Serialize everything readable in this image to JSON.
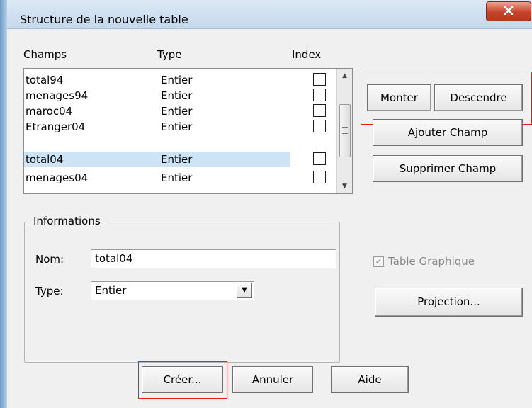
{
  "window": {
    "title": "Structure de la nouvelle table",
    "close_label": "x"
  },
  "columns": {
    "champs": "Champs",
    "type": "Type",
    "index": "Index"
  },
  "fields": [
    {
      "name": "total94",
      "type": "Entier",
      "indexed": false,
      "selected": false
    },
    {
      "name": "menages94",
      "type": "Entier",
      "indexed": false,
      "selected": false
    },
    {
      "name": "maroc04",
      "type": "Entier",
      "indexed": false,
      "selected": false
    },
    {
      "name": "Etranger04",
      "type": "Entier",
      "indexed": false,
      "selected": false
    },
    {
      "name": "total04",
      "type": "Entier",
      "indexed": false,
      "selected": true
    },
    {
      "name": "menages04",
      "type": "Entier",
      "indexed": false,
      "selected": false
    }
  ],
  "buttons": {
    "monter": "Monter",
    "descendre": "Descendre",
    "ajouter": "Ajouter Champ",
    "supprimer": "Supprimer Champ",
    "projection": "Projection...",
    "creer": "Créer...",
    "annuler": "Annuler",
    "aide": "Aide"
  },
  "informations": {
    "group_title": "Informations",
    "nom_label": "Nom:",
    "nom_value": "total04",
    "type_label": "Type:",
    "type_value": "Entier"
  },
  "table_graphique": {
    "label": "Table Graphique",
    "checked": true,
    "enabled": false
  },
  "highlight_color": "#e02020",
  "selection_color": "#cce4f5"
}
